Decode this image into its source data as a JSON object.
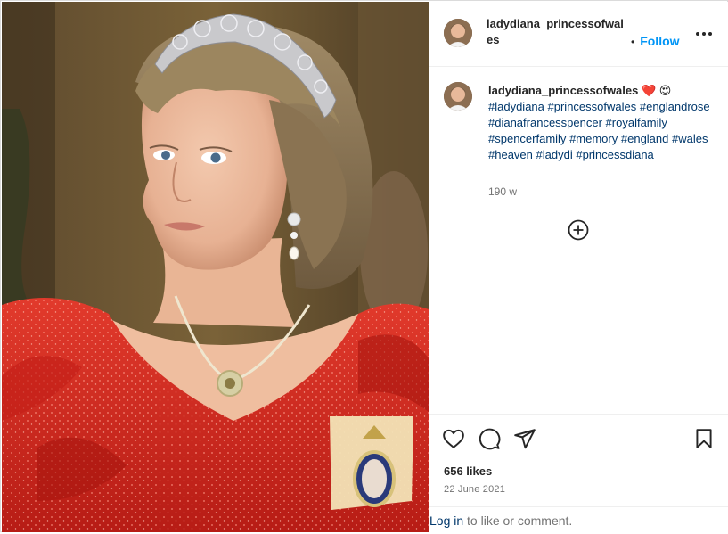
{
  "photo": {
    "alt": "Portrait photo of a woman wearing a diamond tiara, red ruffled dress and pendant necklace"
  },
  "post": {
    "username_line1": "ladydiana_princessofwal",
    "username_line2": "es",
    "follow_dot": "•",
    "follow_label": "Follow",
    "caption_username": "ladydiana_princessofwales",
    "caption_emojis": "❤️ 😍",
    "hashtags": [
      "#ladydiana",
      "#princessofwales",
      "#englandrose",
      "#dianafrancesspencer",
      "#royalfamily",
      "#spencerfamily",
      "#memory",
      "#england",
      "#wales",
      "#heaven",
      "#ladydi",
      "#princessdiana"
    ],
    "time_ago": "190 w",
    "likes": "656 likes",
    "date": "22 June 2021",
    "login_link": "Log in",
    "login_rest": " to like or comment."
  },
  "icons": {
    "more": "more-options-icon",
    "load_more": "plus-circle-icon",
    "like": "heart-icon",
    "comment": "comment-icon",
    "share": "send-icon",
    "save": "bookmark-icon"
  },
  "colors": {
    "link_blue": "#0095f6",
    "hashtag_blue": "#00376b",
    "muted": "#737373",
    "dress_red": "#d7261d"
  }
}
